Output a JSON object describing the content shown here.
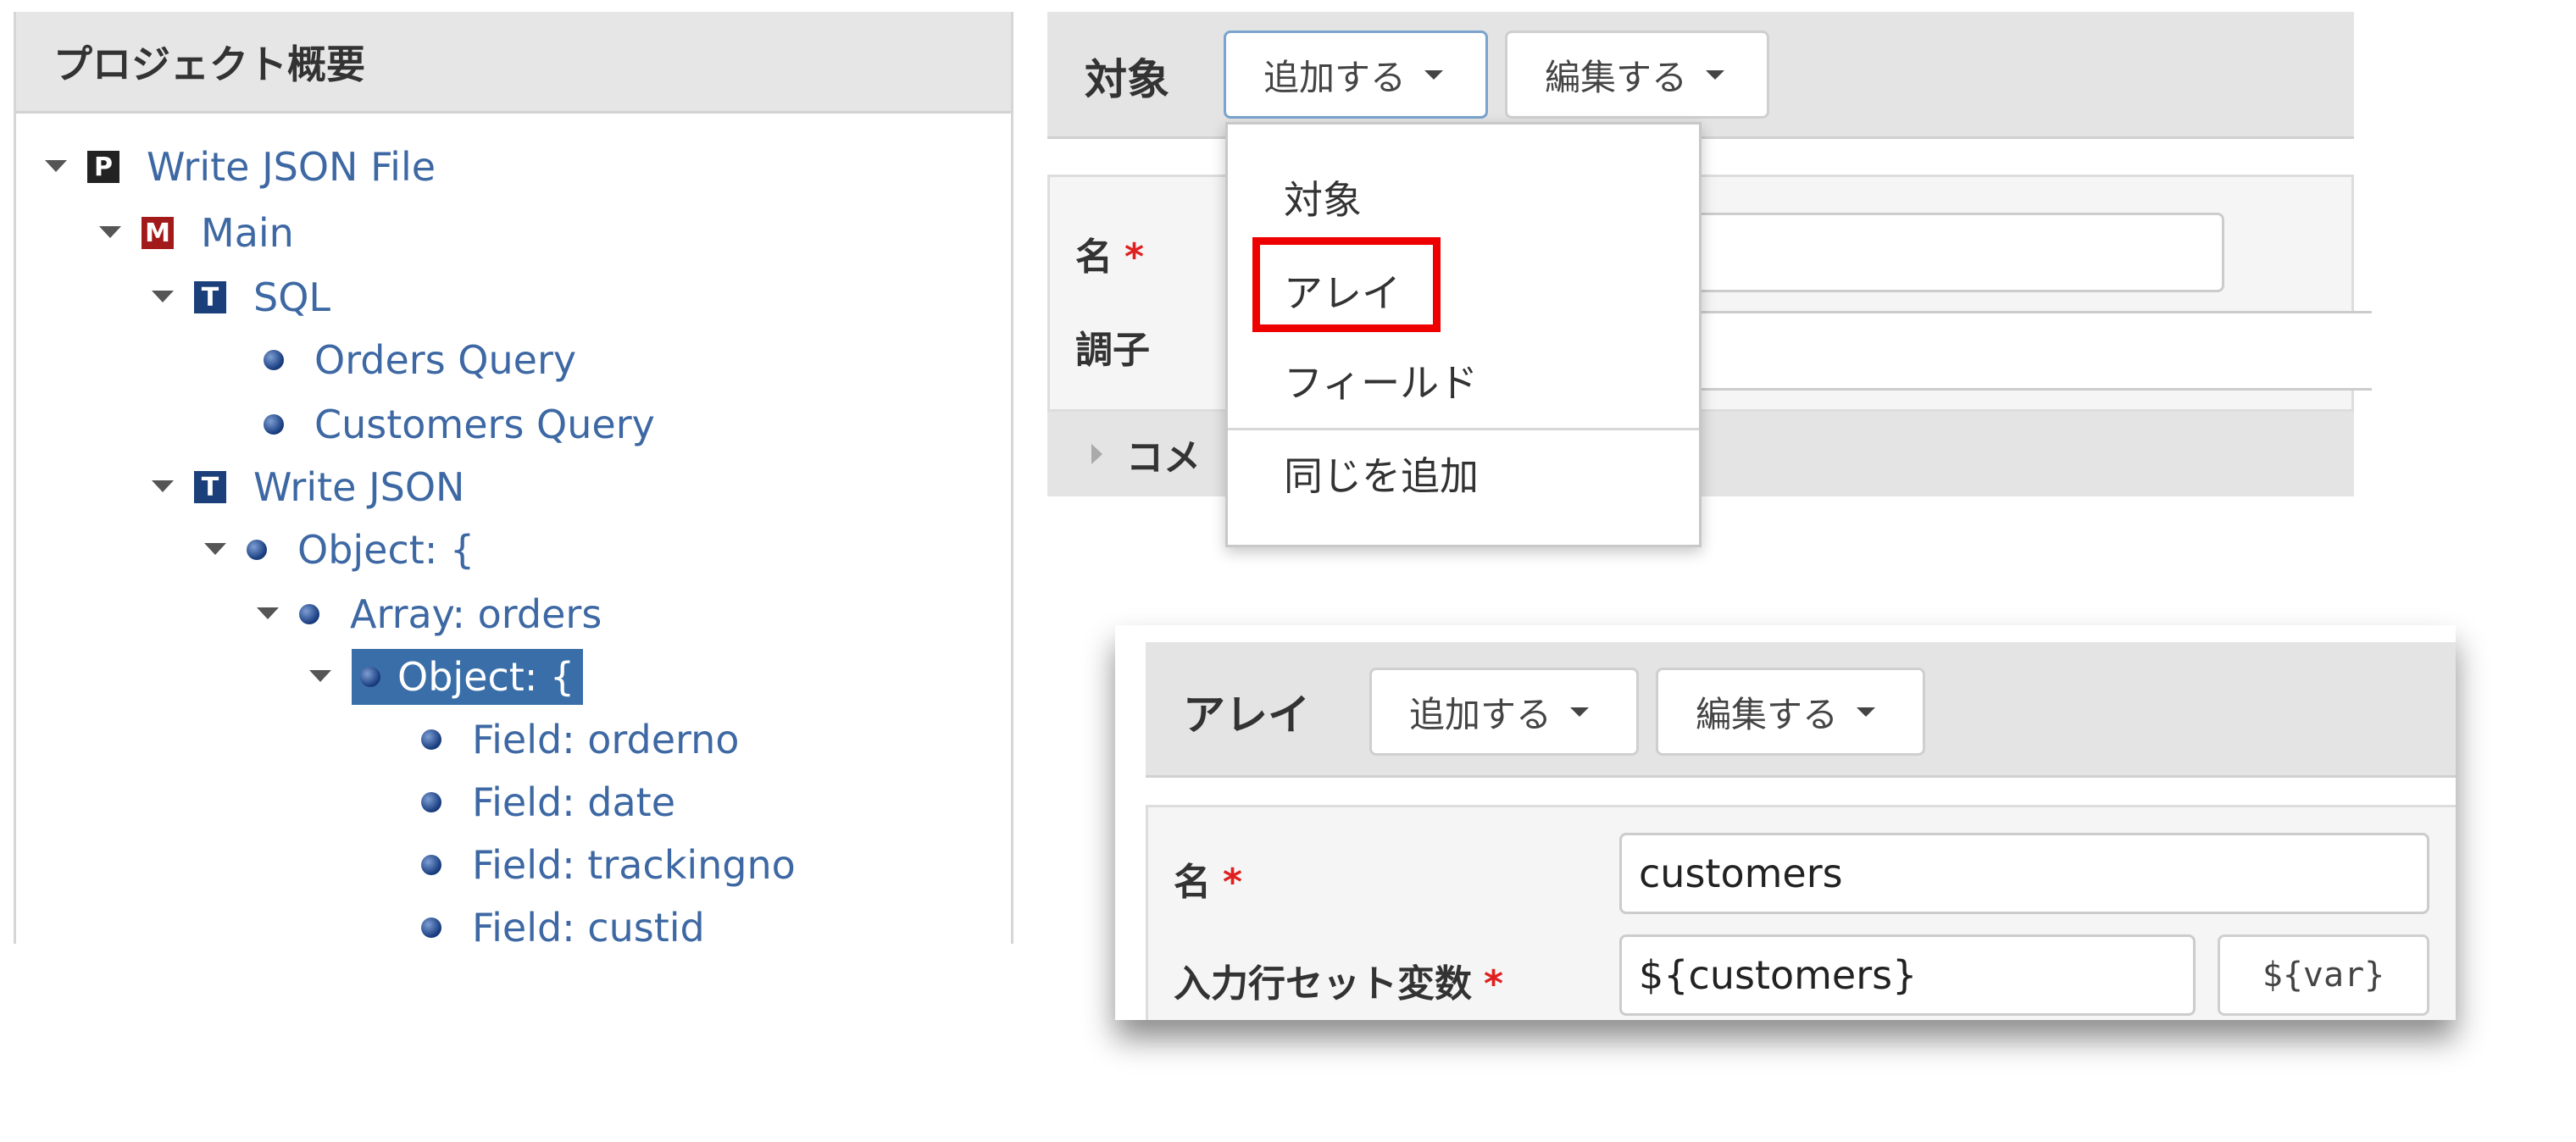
{
  "project_panel": {
    "title": "プロジェクト概要",
    "tree": [
      {
        "label": "Write JSON File",
        "badge": "P",
        "expanded": true
      },
      {
        "label": "Main",
        "badge": "M",
        "expanded": true
      },
      {
        "label": "SQL",
        "badge": "T",
        "expanded": true
      },
      {
        "label": "Orders Query",
        "badge": "dot"
      },
      {
        "label": "Customers Query",
        "badge": "dot"
      },
      {
        "label": "Write JSON",
        "badge": "T",
        "expanded": true
      },
      {
        "label": "Object: {",
        "badge": "dot",
        "expanded": true
      },
      {
        "label": "Array: orders",
        "badge": "dot",
        "expanded": true
      },
      {
        "label": "Object: {",
        "badge": "dot",
        "expanded": true,
        "selected": true
      },
      {
        "label": "Field: orderno",
        "badge": "dot"
      },
      {
        "label": "Field: date",
        "badge": "dot"
      },
      {
        "label": "Field: trackingno",
        "badge": "dot"
      },
      {
        "label": "Field: custid",
        "badge": "dot"
      }
    ]
  },
  "object_editor": {
    "title": "対象",
    "add_button": "追加する",
    "edit_button": "編集する",
    "name_label": "名",
    "required_mark": "*",
    "type_label": "調子",
    "comment_label": "コメ",
    "add_menu": {
      "items": [
        "対象",
        "アレイ",
        "フィールド"
      ],
      "extra_item": "同じを追加",
      "highlighted": "アレイ"
    }
  },
  "array_editor": {
    "title": "アレイ",
    "add_button": "追加する",
    "edit_button": "編集する",
    "name_label": "名",
    "name_value": "customers",
    "rowset_label": "入力行セット変数",
    "rowset_value": "${customers}",
    "required_mark": "*",
    "var_button": "${var}"
  },
  "colors": {
    "tree_link": "#3d68a3",
    "selection": "#3a6ea9",
    "highlight_border": "#ee0000",
    "required": "#e02020"
  }
}
